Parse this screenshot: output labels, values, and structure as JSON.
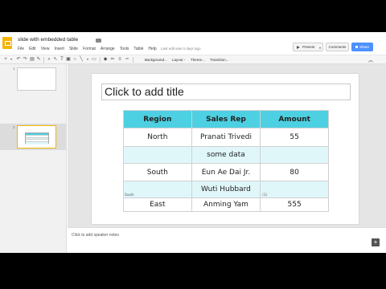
{
  "app": {
    "doc_title": "slide with embedded table",
    "saved_note": "Last edit was 0 days ago",
    "menu": [
      "File",
      "Edit",
      "View",
      "Insert",
      "Slide",
      "Format",
      "Arrange",
      "Tools",
      "Table",
      "Help"
    ],
    "present_label": "Present",
    "comments_label": "Comments",
    "share_label": "Share",
    "accent_color": "#f4b400",
    "share_color": "#4d90fe"
  },
  "toolbar": {
    "background": "Background...",
    "layout": "Layout -",
    "theme": "Theme...",
    "transition": "Transition..."
  },
  "filmstrip": {
    "slides": [
      {
        "number": "1"
      },
      {
        "number": "2"
      }
    ]
  },
  "slide": {
    "title_placeholder": "Click to add title",
    "table": {
      "header_color": "#4dd0e1",
      "stripe_color": "#e0f7fa",
      "headers": [
        "Region",
        "Sales Rep",
        "Amount"
      ],
      "rows": [
        [
          "North",
          "Pranati Trivedi",
          "55"
        ],
        [
          "",
          "some data",
          ""
        ],
        [
          "South",
          "Eun Ae Dai Jr.",
          "80"
        ],
        [
          "",
          "Wuti Hubbard",
          ""
        ],
        [
          "East",
          "Anming Yam",
          "555"
        ]
      ],
      "ghost_left": "South",
      "ghost_right": "(1)"
    }
  },
  "notes": {
    "placeholder": "Click to add speaker notes"
  }
}
